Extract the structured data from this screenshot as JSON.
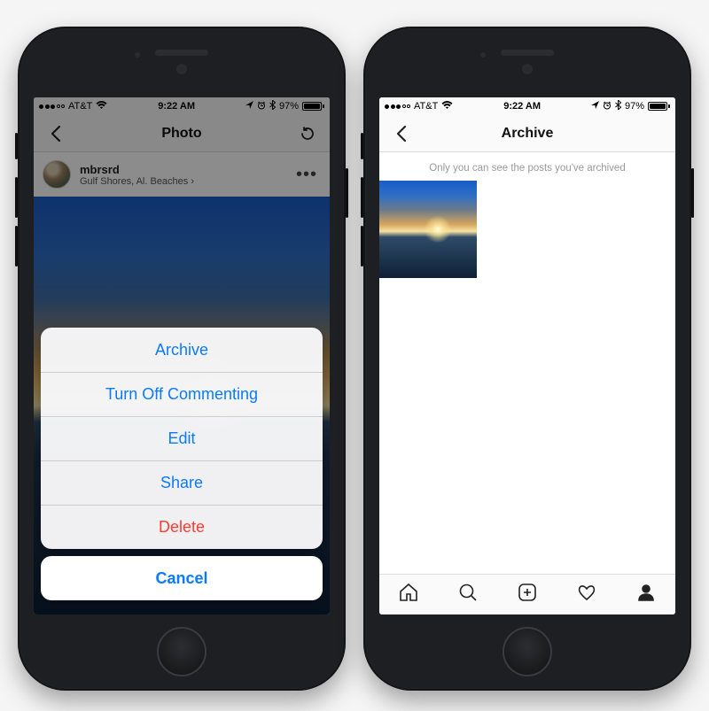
{
  "statusbar": {
    "carrier": "AT&T",
    "time": "9:22 AM",
    "battery_pct": "97%"
  },
  "left": {
    "nav_title": "Photo",
    "username": "mbrsrd",
    "location": "Gulf Shores, Al. Beaches",
    "actions": {
      "archive": "Archive",
      "turn_off_commenting": "Turn Off Commenting",
      "edit": "Edit",
      "share": "Share",
      "delete": "Delete",
      "cancel": "Cancel"
    }
  },
  "right": {
    "nav_title": "Archive",
    "info_text": "Only you can see the posts you've archived"
  }
}
